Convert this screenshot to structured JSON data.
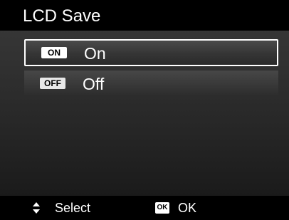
{
  "title": "LCD Save",
  "options": [
    {
      "badge": "ON",
      "label": "On",
      "selected": true
    },
    {
      "badge": "OFF",
      "label": "Off",
      "selected": false
    }
  ],
  "footer": {
    "navigate_icon": "up-down-arrows-icon",
    "select_label": "Select",
    "ok_badge": "OK",
    "ok_label": "OK"
  },
  "colors": {
    "bar_background": "#000000",
    "text": "#ffffff",
    "selection_border": "#ffffff"
  }
}
